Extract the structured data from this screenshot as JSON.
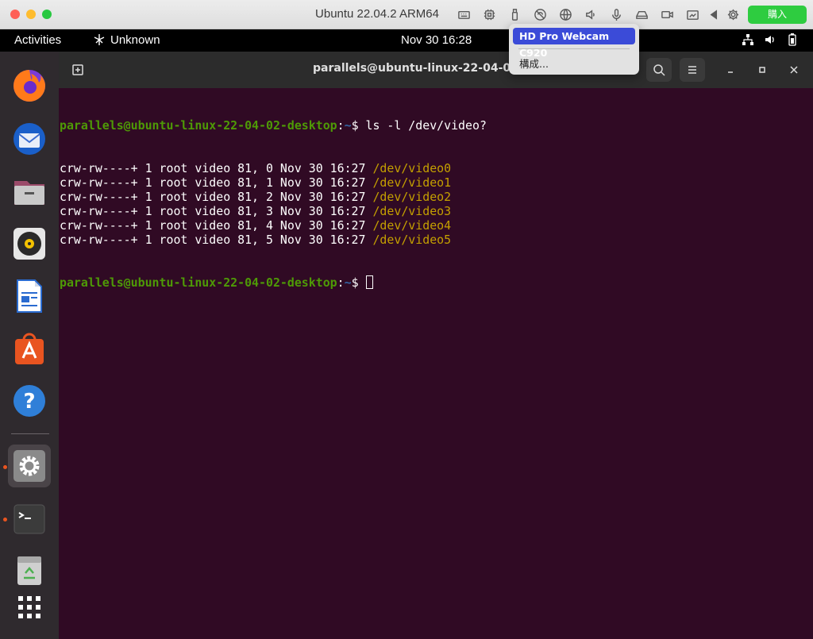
{
  "mac_window": {
    "title": "Ubuntu 22.04.2 ARM64",
    "buy_label": "購入",
    "toolbar_icons": [
      "keyboard-icon",
      "cpu-icon",
      "usb-icon",
      "network-off-icon",
      "globe-icon",
      "speaker-icon",
      "microphone-icon",
      "drive-icon",
      "camera-icon",
      "image-transfer-icon",
      "play-left-icon",
      "gear-icon"
    ]
  },
  "top_bar": {
    "activities": "Activities",
    "network_label": "Unknown",
    "datetime": "Nov 30  16:28"
  },
  "dock": {
    "items": [
      "firefox",
      "thunderbird",
      "files",
      "rhythmbox",
      "libreoffice-writer",
      "ubuntu-software",
      "help",
      "settings",
      "terminal",
      "trash",
      "show-apps"
    ]
  },
  "terminal": {
    "title": "parallels@ubuntu-linux-22-04-02-d",
    "prompt_user": "parallels@ubuntu-linux-22-04-02-desktop",
    "prompt_path": "~",
    "command": "ls -l /dev/video?",
    "entries": [
      {
        "info": "crw-rw----+ 1 root video 81, 0 Nov 30 16:27 ",
        "device": "/dev/video0"
      },
      {
        "info": "crw-rw----+ 1 root video 81, 1 Nov 30 16:27 ",
        "device": "/dev/video1"
      },
      {
        "info": "crw-rw----+ 1 root video 81, 2 Nov 30 16:27 ",
        "device": "/dev/video2"
      },
      {
        "info": "crw-rw----+ 1 root video 81, 3 Nov 30 16:27 ",
        "device": "/dev/video3"
      },
      {
        "info": "crw-rw----+ 1 root video 81, 4 Nov 30 16:27 ",
        "device": "/dev/video4"
      },
      {
        "info": "crw-rw----+ 1 root video 81, 5 Nov 30 16:27 ",
        "device": "/dev/video5"
      }
    ]
  },
  "usb_menu": {
    "device": "HD Pro Webcam C920",
    "configure": "構成..."
  }
}
